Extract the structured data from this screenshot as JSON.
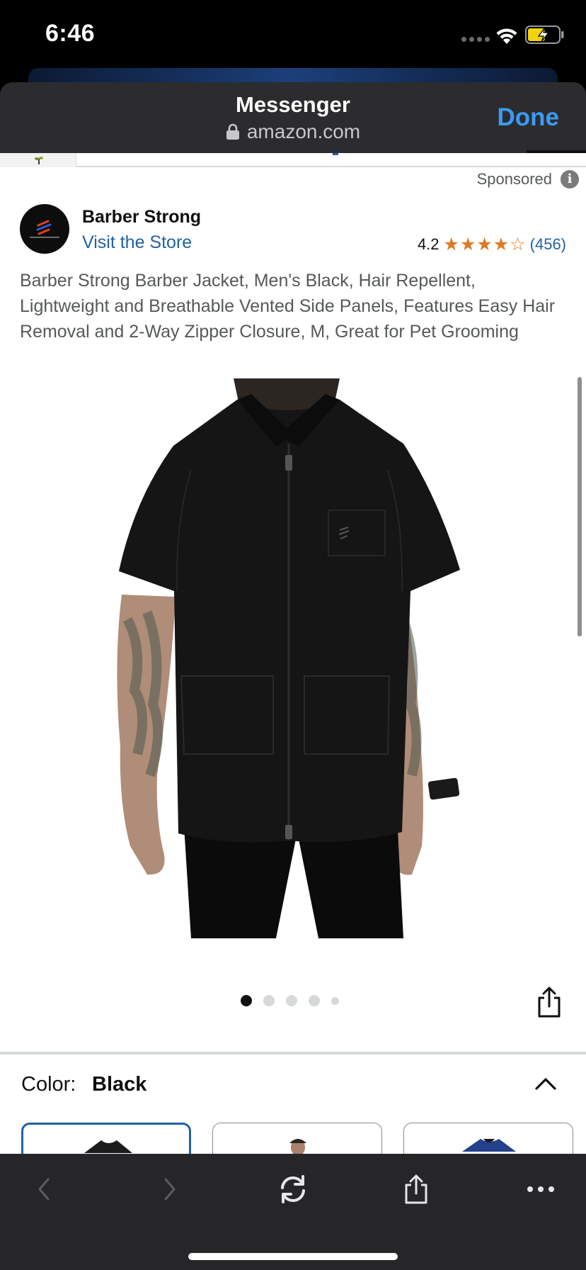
{
  "status_bar": {
    "time": "6:46"
  },
  "sheet": {
    "title": "Messenger",
    "url": "amazon.com",
    "done_label": "Done"
  },
  "product": {
    "sponsored_label": "Sponsored",
    "brand": "Barber Strong",
    "store_link": "Visit the Store",
    "rating": "4.2",
    "rating_stars": 4.2,
    "rating_count": "(456)",
    "title": "Barber Strong Barber Jacket, Men's Black, Hair Repellent, Lightweight and Breathable Vented Side Panels, Features Easy Hair Removal and 2-Way Zipper Closure, M, Great for Pet Grooming",
    "image_count": 5,
    "active_image": 1
  },
  "color_selector": {
    "label": "Color:",
    "value": "Black",
    "swatches": [
      "black",
      "gray",
      "blue"
    ]
  },
  "colors": {
    "link": "#2162a1",
    "star": "#de7921",
    "done": "#3b9af4",
    "sheet_bg": "#2c2c2e",
    "toolbar_bg": "#262628"
  },
  "icons": {
    "lock": "lock-icon",
    "info": "info-icon",
    "share": "share-icon",
    "collapse": "chevron-up-icon",
    "back": "chevron-left-icon",
    "forward": "chevron-right-icon",
    "reload": "reload-icon",
    "more": "ellipsis-icon"
  }
}
